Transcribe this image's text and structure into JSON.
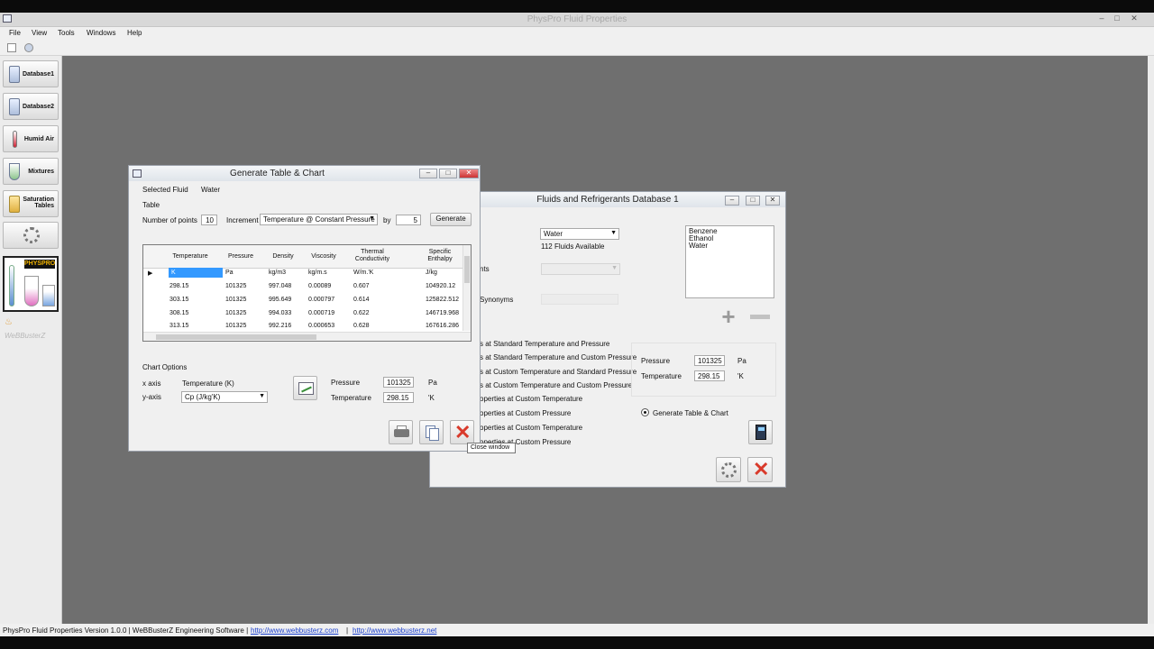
{
  "app": {
    "title": "PhysPro Fluid Properties",
    "menu": [
      "File",
      "View",
      "Tools",
      "Windows",
      "Help"
    ]
  },
  "sidebar": {
    "items": [
      {
        "label": "Database1"
      },
      {
        "label": "Database2"
      },
      {
        "label": "Humid Air"
      },
      {
        "label": "Mixtures"
      },
      {
        "label": "Saturation Tables"
      }
    ],
    "logo_text": "PHYSPRO",
    "brand_text": "WeBBusterZ"
  },
  "generate_window": {
    "title": "Generate Table & Chart",
    "selected_fluid_label": "Selected Fluid",
    "selected_fluid_value": "Water",
    "table_label": "Table",
    "number_of_points_label": "Number of points",
    "number_of_points_value": "10",
    "increment_label": "Increment",
    "increment_value": "Temperature @ Constant Pressure",
    "by_label": "by",
    "by_value": "5",
    "generate_label": "Generate",
    "columns": [
      "Temperature",
      "Pressure",
      "Density",
      "Viscosity",
      "Thermal Conductivity",
      "Specific Enthalpy"
    ],
    "units": [
      "K",
      "Pa",
      "kg/m3",
      "kg/m.s",
      "W/m.'K",
      "J/kg"
    ],
    "rows": [
      [
        "298.15",
        "101325",
        "997.048",
        "0.00089",
        "0.607",
        "104920.12"
      ],
      [
        "303.15",
        "101325",
        "995.649",
        "0.000797",
        "0.614",
        "125822.512"
      ],
      [
        "308.15",
        "101325",
        "994.033",
        "0.000719",
        "0.622",
        "146719.968"
      ],
      [
        "313.15",
        "101325",
        "992.216",
        "0.000653",
        "0.628",
        "167616.286"
      ]
    ],
    "chart_options_label": "Chart Options",
    "x_axis_label": "x axis",
    "x_axis_value": "Temperature (K)",
    "y_axis_label": "y-axis",
    "y_axis_value": "Cp (J/kg'K)",
    "pressure_label": "Pressure",
    "pressure_value": "101325",
    "pressure_unit": "Pa",
    "temperature_label": "Temperature",
    "temperature_value": "298.15",
    "temperature_unit": "'K",
    "tooltip": "Close window"
  },
  "db_window": {
    "title": "Fluids and Refrigerants Database 1",
    "fluid_value": "Water",
    "fluids_available": "112 Fluids Available",
    "label_nts": "nts",
    "label_synonyms": "Synonyms",
    "list_items": [
      "Benzene",
      "Ethanol",
      "Water"
    ],
    "options": [
      "s at Standard Temperature and Pressure",
      "s at Standard Temperature and Custom Pressure",
      "s at Custom Temperature and Standard Pressure",
      "s at Custom Temperature and Custom Pressure",
      "operties at Custom Temperature",
      "operties at Custom Pressure",
      "operties at Custom Temperature",
      "operties at Custom Pressure"
    ],
    "pressure_label": "Pressure",
    "pressure_value": "101325",
    "pressure_unit": "Pa",
    "temperature_label": "Temperature",
    "temperature_value": "298.15",
    "temperature_unit": "'K",
    "generate_table_chart_label": "Generate Table & Chart"
  },
  "status": {
    "text": "PhysPro Fluid Properties  Version 1.0.0  |  WeBBusterZ Engineering Software  |",
    "link1": "http://www.webbusterz.com",
    "sep": "|",
    "link2": "http://www.webbusterz.net"
  }
}
